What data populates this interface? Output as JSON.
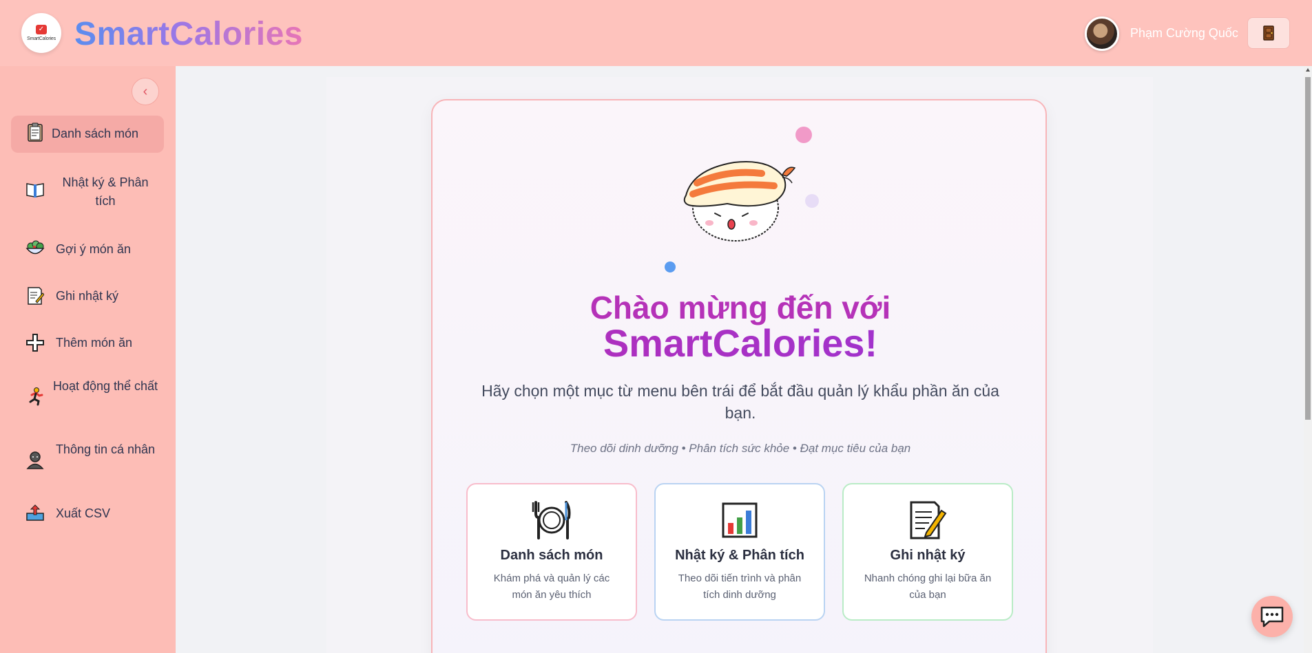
{
  "header": {
    "logo_text": "SmartCalories",
    "brand": "SmartCalories",
    "user_name": "Phạm Cường Quốc",
    "logout_icon": "door-icon"
  },
  "sidebar": {
    "collapse_icon": "chevron-left-icon",
    "items": [
      {
        "label": "Danh sách món",
        "icon": "clipboard-icon",
        "active": true
      },
      {
        "label": "Nhật ký & Phân tích",
        "icon": "book-icon"
      },
      {
        "label": "Gợi ý món ăn",
        "icon": "salad-icon"
      },
      {
        "label": "Ghi nhật ký",
        "icon": "memo-icon"
      },
      {
        "label": "Thêm món ăn",
        "icon": "plus-icon"
      },
      {
        "label": "Hoạt động thể chất",
        "icon": "runner-icon"
      },
      {
        "label": "Thông tin cá nhân",
        "icon": "person-icon"
      },
      {
        "label": "Xuất CSV",
        "icon": "outbox-icon"
      }
    ]
  },
  "welcome": {
    "title_line1": "Chào mừng đến với",
    "title_line2": "SmartCalories!",
    "subtitle": "Hãy chọn một mục từ menu bên trái để bắt đầu quản lý khẩu phần ăn của bạn.",
    "tagline": "Theo dõi dinh dưỡng • Phân tích sức khỏe • Đạt mục tiêu của bạn",
    "mascot": "sushi-mascot"
  },
  "features": [
    {
      "title": "Danh sách món",
      "desc": "Khám phá và quản lý các món ăn yêu thích",
      "icon": "fork-plate-knife-icon",
      "border": "#f8bccb"
    },
    {
      "title": "Nhật ký & Phân tích",
      "desc": "Theo dõi tiến trình và phân tích dinh dưỡng",
      "icon": "bar-chart-icon",
      "border": "#b9d3f2"
    },
    {
      "title": "Ghi nhật ký",
      "desc": "Nhanh chóng ghi lại bữa ăn của bạn",
      "icon": "memo-pencil-icon",
      "border": "#b9ecc6"
    }
  ],
  "chat": {
    "icon": "chat-bubble-icon"
  }
}
